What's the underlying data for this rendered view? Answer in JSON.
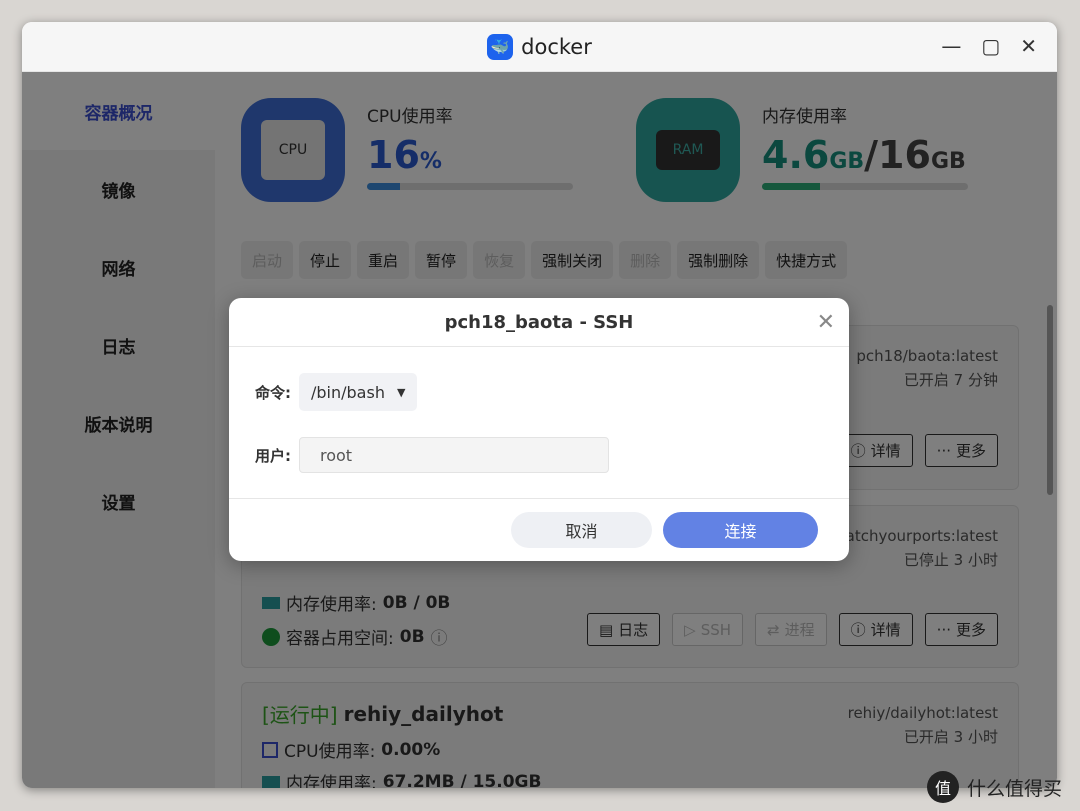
{
  "window": {
    "title": "docker"
  },
  "sidebar": {
    "items": [
      {
        "label": "容器概况",
        "active": true
      },
      {
        "label": "镜像"
      },
      {
        "label": "网络"
      },
      {
        "label": "日志"
      },
      {
        "label": "版本说明"
      },
      {
        "label": "设置"
      }
    ]
  },
  "stats": {
    "cpu": {
      "label": "CPU使用率",
      "value": "16",
      "unit": "%",
      "percent": 16,
      "icon_text": "CPU",
      "color": "#2a5bd0"
    },
    "ram": {
      "label": "内存使用率",
      "used": "4.6",
      "used_unit": "GB",
      "sep": "/",
      "total": "16",
      "total_unit": "GB",
      "percent": 28,
      "icon_text": "RAM",
      "color": "#17907f"
    }
  },
  "toolbar": [
    {
      "label": "启动",
      "disabled": true
    },
    {
      "label": "停止"
    },
    {
      "label": "重启"
    },
    {
      "label": "暂停"
    },
    {
      "label": "恢复",
      "disabled": true
    },
    {
      "label": "强制关闭"
    },
    {
      "label": "删除",
      "disabled": true
    },
    {
      "label": "强制删除"
    },
    {
      "label": "快捷方式"
    }
  ],
  "cards": [
    {
      "image": "pch18/baota:latest",
      "uptime": "已开启 7 分钟",
      "buttons": [
        "详情",
        "更多"
      ]
    },
    {
      "image": "watchyourports:latest",
      "uptime": "已停止 3 小时",
      "mem_label": "内存使用率:",
      "mem_value": "0B / 0B",
      "disk_label": "容器占用空间:",
      "disk_value": "0B",
      "buttons": [
        {
          "label": "日志"
        },
        {
          "label": "SSH",
          "disabled": true
        },
        {
          "label": "进程",
          "disabled": true
        },
        {
          "label": "详情"
        },
        {
          "label": "更多"
        }
      ]
    },
    {
      "status": "[运行中]",
      "name": "rehiy_dailyhot",
      "image": "rehiy/dailyhot:latest",
      "uptime": "已开启 3 小时",
      "cpu_label": "CPU使用率:",
      "cpu_value": "0.00%",
      "mem_label": "内存使用率:",
      "mem_value": "67.2MB / 15.0GB"
    }
  ],
  "dialog": {
    "title": "pch18_baota - SSH",
    "command_label": "命令:",
    "command_value": "/bin/bash",
    "user_label": "用户:",
    "user_value": "root",
    "cancel": "取消",
    "connect": "连接",
    "accent": "#6282e4"
  },
  "watermark": {
    "logo": "值",
    "text": "什么值得买"
  }
}
